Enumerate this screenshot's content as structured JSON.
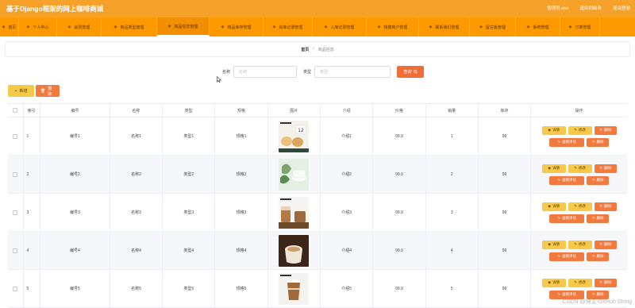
{
  "app": {
    "title": "基于Django框架的网上咖啡商城"
  },
  "top_links": [
    "管理员 abo",
    "退出到前台",
    "退出登录"
  ],
  "nav": [
    {
      "label": "首页",
      "icon": "home-icon",
      "active": false,
      "w": 24
    },
    {
      "label": "个人中心",
      "icon": "user-icon",
      "active": false,
      "w": 48
    },
    {
      "label": "会员管理",
      "icon": "users-icon",
      "active": false,
      "w": 56
    },
    {
      "label": "商品类型管理",
      "icon": "list-icon",
      "active": false,
      "w": 70
    },
    {
      "label": "商品信息管理",
      "icon": "goods-icon",
      "active": true,
      "w": 66
    },
    {
      "label": "商品库存管理",
      "icon": "box-icon",
      "active": false,
      "w": 68
    },
    {
      "label": "出库记录管理",
      "icon": "out-icon",
      "active": false,
      "w": 62
    },
    {
      "label": "入库记录管理",
      "icon": "in-icon",
      "active": false,
      "w": 68
    },
    {
      "label": "快捷商户管理",
      "icon": "shop-icon",
      "active": false,
      "w": 66
    },
    {
      "label": "联系我们管理",
      "icon": "contact-icon",
      "active": false,
      "w": 64
    },
    {
      "label": "留言板管理",
      "icon": "message-icon",
      "active": false,
      "w": 58
    },
    {
      "label": "系统管理",
      "icon": "settings-icon",
      "active": false,
      "w": 56
    },
    {
      "label": "订单管理",
      "icon": "order-icon",
      "active": false,
      "w": 50
    }
  ],
  "breadcrumb": {
    "home": "首页",
    "sep": "/",
    "current": "商品信息"
  },
  "search": {
    "name_label": "名称",
    "name_placeholder": "名称",
    "type_label": "类型",
    "type_placeholder": "类型",
    "button": "查询"
  },
  "actions": {
    "add": "新增",
    "delete": "删除"
  },
  "table": {
    "headers": [
      "",
      "索引",
      "编号",
      "名称",
      "类型",
      "规格",
      "图片",
      "介绍",
      "价格",
      "销量",
      "库存",
      "操作"
    ],
    "ops": {
      "detail": "详情",
      "edit": "修改",
      "delete": "删除",
      "review": "查看评论"
    },
    "rows": [
      {
        "index": "1",
        "code": "编号1",
        "name": "名称1",
        "type": "类型1",
        "spec": "规格1",
        "intro": "介绍1",
        "price": "99.9",
        "sales": "1",
        "stock": "99"
      },
      {
        "index": "2",
        "code": "编号2",
        "name": "名称2",
        "type": "类型2",
        "spec": "规格2",
        "intro": "介绍2",
        "price": "99.9",
        "sales": "2",
        "stock": "99"
      },
      {
        "index": "3",
        "code": "编号3",
        "name": "名称3",
        "type": "类型3",
        "spec": "规格3",
        "intro": "介绍3",
        "price": "99.9",
        "sales": "3",
        "stock": "99"
      },
      {
        "index": "4",
        "code": "编号4",
        "name": "名称4",
        "type": "类型4",
        "spec": "规格4",
        "intro": "介绍4",
        "price": "99.9",
        "sales": "4",
        "stock": "99"
      },
      {
        "index": "5",
        "code": "编号5",
        "name": "名称5",
        "type": "类型5",
        "spec": "规格5",
        "intro": "介绍5",
        "price": "99.9",
        "sales": "5",
        "stock": "99"
      }
    ]
  },
  "watermark": "CSDN @博主-GitHub String",
  "colors": {
    "brand": "#ff9900",
    "accent": "#f27a3e",
    "yellow": "#f7c948"
  }
}
